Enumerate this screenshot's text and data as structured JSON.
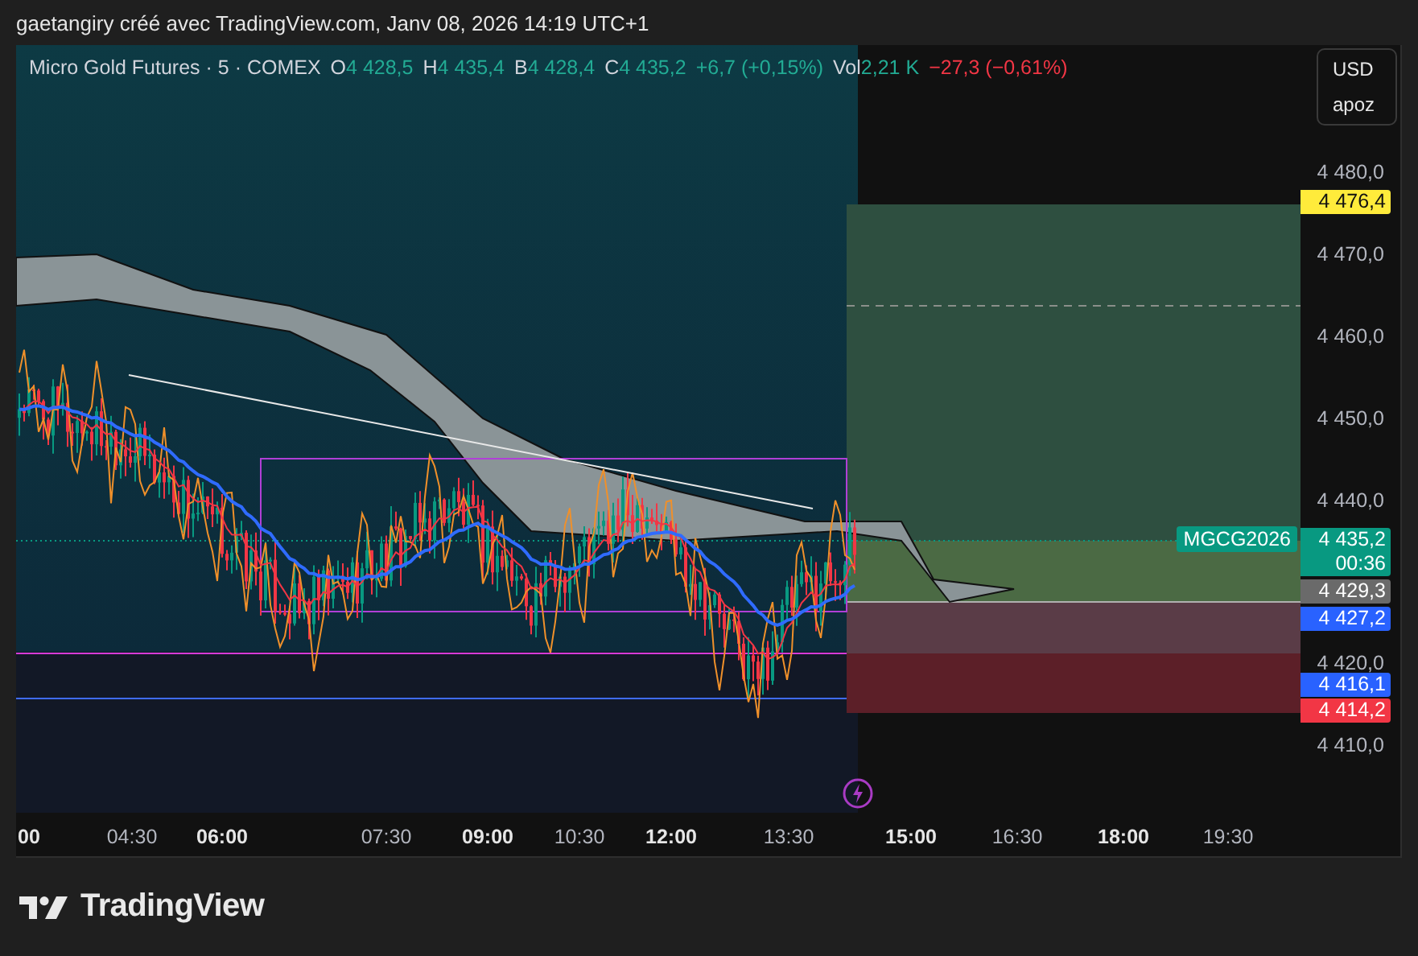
{
  "header": {
    "text": "gaetangiry créé avec TradingView.com, Janv 08, 2026 14:19 UTC+1"
  },
  "legend": {
    "symbol": "Micro Gold Futures · 5 · COMEX",
    "ohlc": [
      {
        "label": "O",
        "value": "4 428,5"
      },
      {
        "label": "H",
        "value": "4 435,4"
      },
      {
        "label": "B",
        "value": "4 428,4"
      },
      {
        "label": "C",
        "value": "4 435,2"
      }
    ],
    "change": {
      "text": "+6,7 (+0,15%)",
      "rising": true
    },
    "volume": {
      "label": "Vol",
      "value": "2,21 K",
      "change": "−27,3 (−0,61%)",
      "rising": false
    }
  },
  "currency_button": {
    "currency": "USD",
    "unit": "apoz"
  },
  "price_axis": {
    "labels": [
      "4 480,0",
      "4 470,0",
      "4 460,0",
      "4 450,0",
      "4 440,0",
      "4 420,0",
      "4 410,0"
    ]
  },
  "price_badges": [
    {
      "text": "4 476,4",
      "color": "#ffeb3b"
    },
    {
      "text": "4 435,2",
      "sub": "00:36",
      "color": "#089981"
    },
    {
      "text": "4 429,3",
      "color": "#6a6a6a"
    },
    {
      "text": "4 427,2",
      "color": "#2962ff"
    },
    {
      "text": "4 416,1",
      "color": "#2962ff"
    },
    {
      "text": "4 414,2",
      "color": "#f23645"
    }
  ],
  "symbol_tag": {
    "text": "MGCG2026",
    "color": "#089981"
  },
  "time_axis": {
    "labels": [
      {
        "text": "00",
        "major": true
      },
      {
        "text": "04:30",
        "major": false
      },
      {
        "text": "06:00",
        "major": true
      },
      {
        "text": "07:30",
        "major": false
      },
      {
        "text": "09:00",
        "major": true
      },
      {
        "text": "10:30",
        "major": false
      },
      {
        "text": "12:00",
        "major": true
      },
      {
        "text": "13:30",
        "major": false
      },
      {
        "text": "15:00",
        "major": true
      },
      {
        "text": "16:30",
        "major": false
      },
      {
        "text": "18:00",
        "major": true
      },
      {
        "text": "19:30",
        "major": false
      }
    ]
  },
  "footer": {
    "logo_text": "TradingView"
  }
}
